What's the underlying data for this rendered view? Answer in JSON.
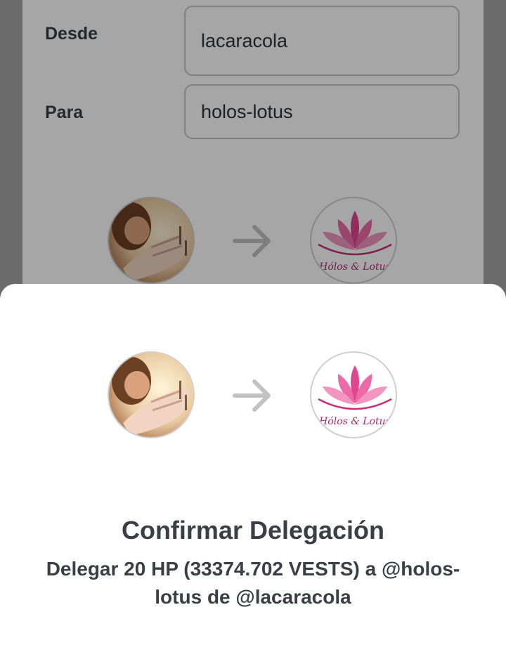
{
  "form": {
    "from_label": "Desde",
    "from_value": "lacaracola",
    "to_label": "Para",
    "to_value": "holos-lotus"
  },
  "avatars": {
    "from_icon": "user-photo-avatar",
    "to_icon": "holos-lotus-logo",
    "to_logo_text": "Hólos & Lotus"
  },
  "sheet": {
    "title": "Confirmar Delegación",
    "description": "Delegar 20 HP (33374.702 VESTS) a @holos-lotus de @lacaracola"
  },
  "colors": {
    "text": "#3a3f45",
    "lotus_pink": "#e0458f",
    "arrow": "#c2c2c2"
  }
}
